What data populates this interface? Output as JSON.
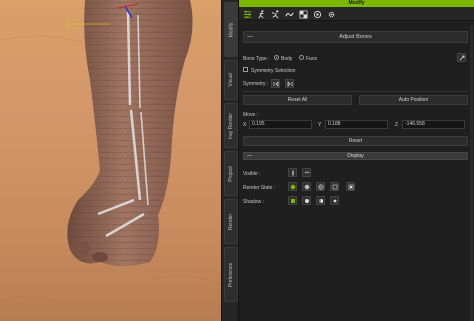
{
  "panel": {
    "title": "Modify",
    "accent_color": "#7ab800"
  },
  "tabs": [
    "Modify",
    "Visual",
    "Iray Render",
    "Project",
    "Render",
    "Preference"
  ],
  "toolbar_icons": [
    "sliders-icon",
    "run-pose-icon",
    "motion-icon",
    "morph-icon",
    "checker-icon",
    "appearance-icon",
    "gear-icon"
  ],
  "adjust_bones": {
    "collapse_glyph": "—",
    "label": "Adjust Bones"
  },
  "bone_type": {
    "label": "Bone Type :",
    "options": [
      "Body",
      "Face"
    ],
    "selected": "Body"
  },
  "symmetry_selection": {
    "label": "Symmetry Selection",
    "checked": false
  },
  "symmetry": {
    "label": "Symmetry :"
  },
  "buttons": {
    "reset_all": "Reset All",
    "auto_position": "Auto Position",
    "reset": "Reset"
  },
  "move": {
    "label": "Move :",
    "x_label": "X",
    "x_value": "0.195",
    "y_label": "Y",
    "y_value": "0.188",
    "z_label": "Z",
    "z_value": "-146.558"
  },
  "display": {
    "section_label": "Display",
    "visible_label": "Visible :",
    "render_state_label": "Render State :",
    "shadow_label": "Shadow :"
  }
}
